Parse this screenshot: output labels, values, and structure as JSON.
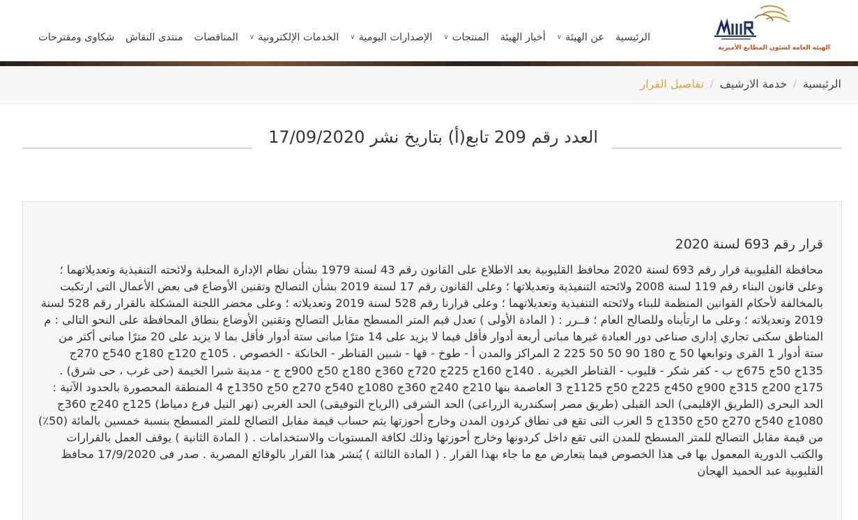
{
  "header": {
    "logo_tagline": "الهيئة العامة لشئون المطابع الأميرية",
    "nav": [
      {
        "label": "الرئيسية",
        "dropdown": false
      },
      {
        "label": "عن الهيئة",
        "dropdown": true
      },
      {
        "label": "أخبار الهيئة",
        "dropdown": false
      },
      {
        "label": "المنتجات",
        "dropdown": true
      },
      {
        "label": "الإصدارات اليومية",
        "dropdown": true
      },
      {
        "label": "الخدمات الإلكترونية",
        "dropdown": true
      },
      {
        "label": "المناقصات",
        "dropdown": false
      },
      {
        "label": "منتدى النقاش",
        "dropdown": false
      },
      {
        "label": "شكاوى ومقترحات",
        "dropdown": false
      }
    ]
  },
  "breadcrumb": {
    "items": [
      "الرئيسية",
      "خدمة الارشيف",
      "تفاصيل القرار"
    ],
    "separator": "/"
  },
  "issue": {
    "heading": "العدد رقم 209 تابع(أ) بتاريخ نشر 17/09/2020"
  },
  "decision": {
    "title": "قرار رقم 693 لسنة 2020",
    "body": "محافظة القليوبية قرار رقم 693 لسنة 2020 محافظ القليوبية بعد الاطلاع على القانون رقم 43 لسنة 1979 بشأن نظام الإدارة المحلية ولائحته التنفيذية وتعديلاتهما ؛ وعلى قانون البناء رقم 119 لسنة 2008 ولائحته التنفيذية وتعديلاتها ؛ وعلى القانون رقم 17 لسنة 2019 بشأن التصالح وتقنين الأوضاع فى بعض الأعمال التى ارتكبت بالمخالفة لأحكام القوانين المنظمة للبناء ولائحته التنفيذية وتعديلاتهما ؛ وعلى قرارنا رقم 528 لسنة 2019 وتعديلاته ؛ وعلى محضر اللجنة المشكلة بالقرار رقم 528 لسنة 2019 وتعديلاته ؛ وعلى ما ارتأيناه وللصالح العام ؛ قــرر : ( المادة الأولى ) تعدل قيم المتر المسطح مقابل التصالح وتقنين الأوضاع بنطاق المحافظة على النحو التالى : م المناطق سكنى تجاري إدارى صناعى دور العبادة غيرها مبانى أربعة أدوار فأقل فيما لا يزيد على 14 مترًا مبانى ستة أدوار فأقل بما لا يزيد على 20 مترًا مبانى أكثر من ستة أدوار 1 القرى وتوابعها 50 ج 180 90 50 50 225 2 المراكز والمدن أ - طوخ - قها - شبين القناطر - الخانكة - الخصوص . 105ج 120ج 180ج 540ج 270ج 135ج 50ج 675ج ب - كفر شكر - قليوب - القناطر الخيرية . 140ج 160ج 225ج 720ج 360ج 180ج 50ج 900ج ج - مدينة شبرا الخيمة (حى غرب ، حى شرق) . 175ج 200ج 315ج 900ج 450ج 225ج 50ج 1125ج 3 العاصمة بنها 210ج 240ج 360ج 1080ج 540ج 270ج 50ج 1350ج 4 المنطقة المحصورة بالحدود الآتية : الحد البحرى (الطريق الإقليمى) الحد القبلى (طريق مصر إسكندرية الزراعى) الحد الشرقى (الرياح التوفيقى) الحد الغربى (نهر النيل فرع دمياط) 125ج 240ج 360ج 1080ج 540ج 270ج 50ج 1350ج 5 العزب التى تقع فى نطاق كردون المدن وخارج أحوزتها يتم حساب قيمة مقابل التصالح للمتر المسطح بنسبة خمسين بالمائة (50٪) من قيمة مقابل التصالح للمتر المسطح للمدن التى تقع داخل كردونها وخارج أحوزتها وذلك لكافة المستويات والاستخدامات . ( المادة الثانية ) يوقف العمل بالقرارات والكتب الدورية المعمول بها فى هذا الخصوص فيما يتعارض مع ما جاء بهذا القرار . ( المادة الثالثة ) يُنشر هذا القرار بالوقائع المصرية . صدر فى 17/9/2020 محافظ القليوبية عبد الحميد الهجان"
  }
}
